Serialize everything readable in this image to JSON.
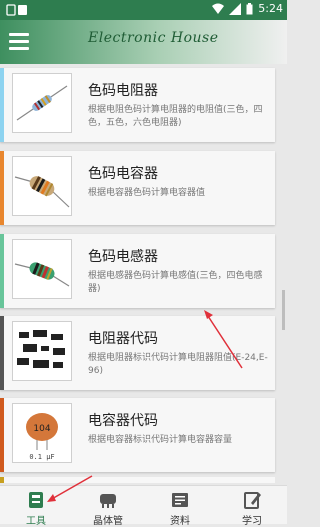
{
  "status_bar": {
    "time": "5:24"
  },
  "app": {
    "title": "Electronic House"
  },
  "items": [
    {
      "title": "色码电阻器",
      "desc": "根据电阻色码计算电阻器的电阻值(三色，四色，五色，六色电阻器)",
      "accent": "#8dd3f0"
    },
    {
      "title": "色码电容器",
      "desc": "根据电容器色码计算电容器值",
      "accent": "#e8862e"
    },
    {
      "title": "色码电感器",
      "desc": "根据电感器色码计算电感值(三色，四色电感器)",
      "accent": "#68c59a"
    },
    {
      "title": "电阻器代码",
      "desc": "根据电阻器标识代码计算电阻器阻值(E-24,E-96)",
      "accent": "#555555"
    },
    {
      "title": "电容器代码",
      "desc": "根据电容器标识代码计算电容器容量",
      "accent": "#d05a1e",
      "thumb_code": "104",
      "thumb_unit": "0.1 μF"
    }
  ],
  "tabs": [
    {
      "label": "工具",
      "icon": "toolbox-icon",
      "active": true
    },
    {
      "label": "晶体管",
      "icon": "transistor-icon",
      "active": false
    },
    {
      "label": "资料",
      "icon": "document-icon",
      "active": false
    },
    {
      "label": "学习",
      "icon": "notebook-edit-icon",
      "active": false
    }
  ],
  "colors": {
    "primary": "#2e7d4f",
    "annotation_arrow": "#e0303a"
  }
}
